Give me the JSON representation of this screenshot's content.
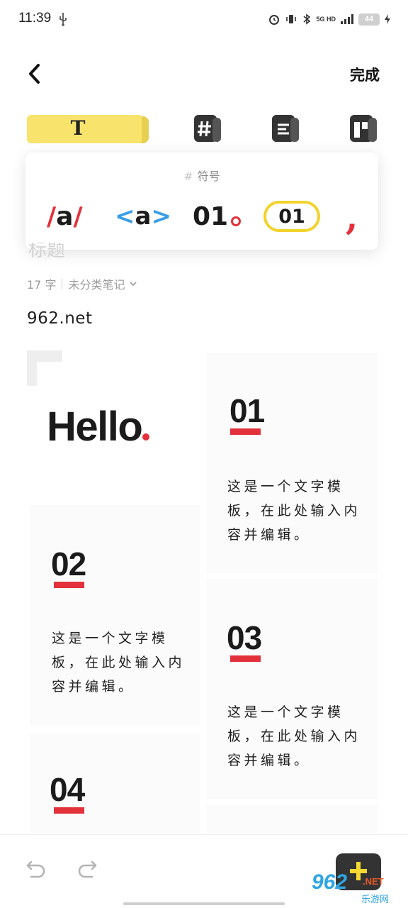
{
  "status_bar": {
    "time": "11:39",
    "network": "5G HD",
    "battery_level": "44"
  },
  "header": {
    "back_icon": "chevron-left-icon",
    "done_label": "完成"
  },
  "toolbar": {
    "text_tool_label": "T",
    "tools": [
      "text-style-icon",
      "symbol-icon",
      "list-icon",
      "layout-icon"
    ]
  },
  "symbol_popover": {
    "title_icon": "#",
    "title": "符号",
    "options": [
      {
        "slash_left": "/",
        "letter": "a",
        "slash_right": "/"
      },
      {
        "left": "<",
        "letter": "a",
        "right": ">"
      },
      {
        "text": "01"
      },
      {
        "text": "01"
      },
      {
        "text": ","
      }
    ]
  },
  "note": {
    "title_peek": "标题",
    "word_count": "17 字",
    "category": "未分类笔记",
    "body_line": "962.net"
  },
  "template": {
    "hello": "Hello",
    "items": [
      {
        "num": "01",
        "text": "这是一个文字模板，在此处输入内容并编辑。"
      },
      {
        "num": "02",
        "text": "这是一个文字模板，在此处输入内容并编辑。"
      },
      {
        "num": "03",
        "text": "这是一个文字模板，在此处输入内容并编辑。"
      },
      {
        "num": "04"
      }
    ]
  },
  "bottom_bar": {
    "watermark": "962",
    "watermark_net": ".NET",
    "watermark_cn": "乐游网"
  },
  "colors": {
    "accent_yellow": "#f8e36d",
    "accent_red": "#e3313b",
    "accent_blue": "#3a9ee6"
  }
}
